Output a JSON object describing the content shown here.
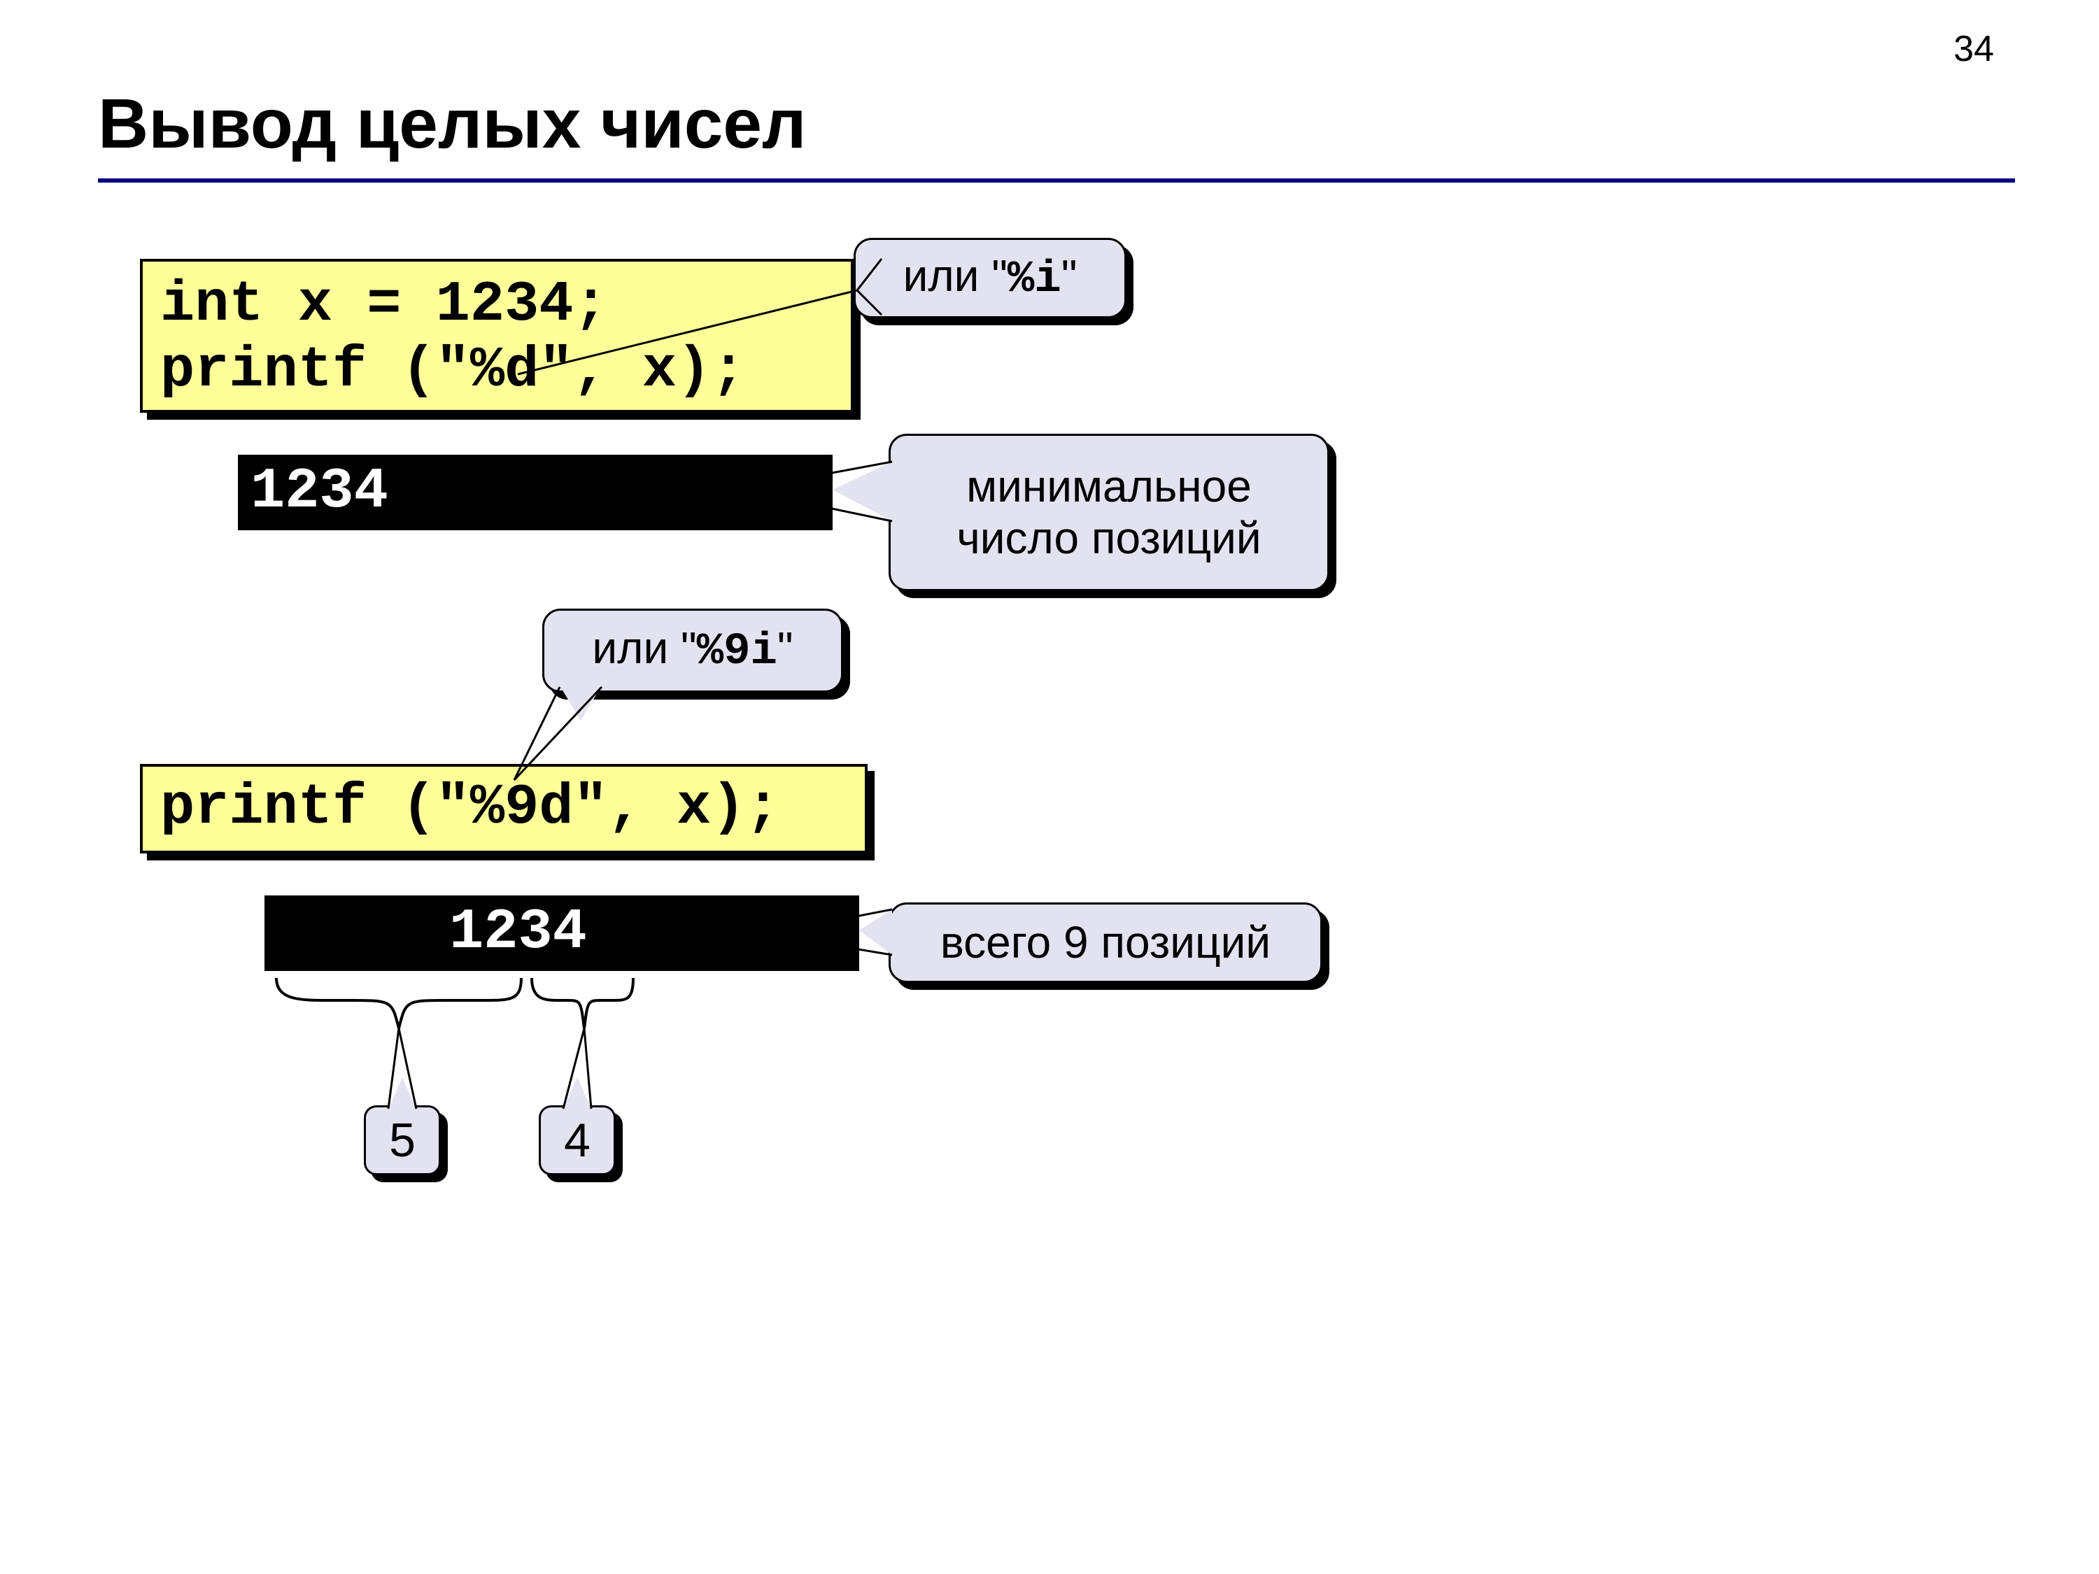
{
  "page_number": "34",
  "title": "Вывод целых чисел",
  "code1_line1": "int x = 1234;",
  "code1_line2": "printf (\"%d\", x);",
  "output1": "1234",
  "callout_i_prefix": "или \"",
  "callout_i_code": "%i",
  "callout_i_suffix": "\"",
  "callout_min_line1": "минимальное",
  "callout_min_line2": "число позиций",
  "callout_9i_prefix": "или \"",
  "callout_9i_code": "%9i",
  "callout_9i_suffix": "\"",
  "code2": "printf (\"%9d\", x);",
  "output2": "     1234",
  "callout_9pos": "всего 9 позиций",
  "brace_left": "5",
  "brace_right": "4"
}
